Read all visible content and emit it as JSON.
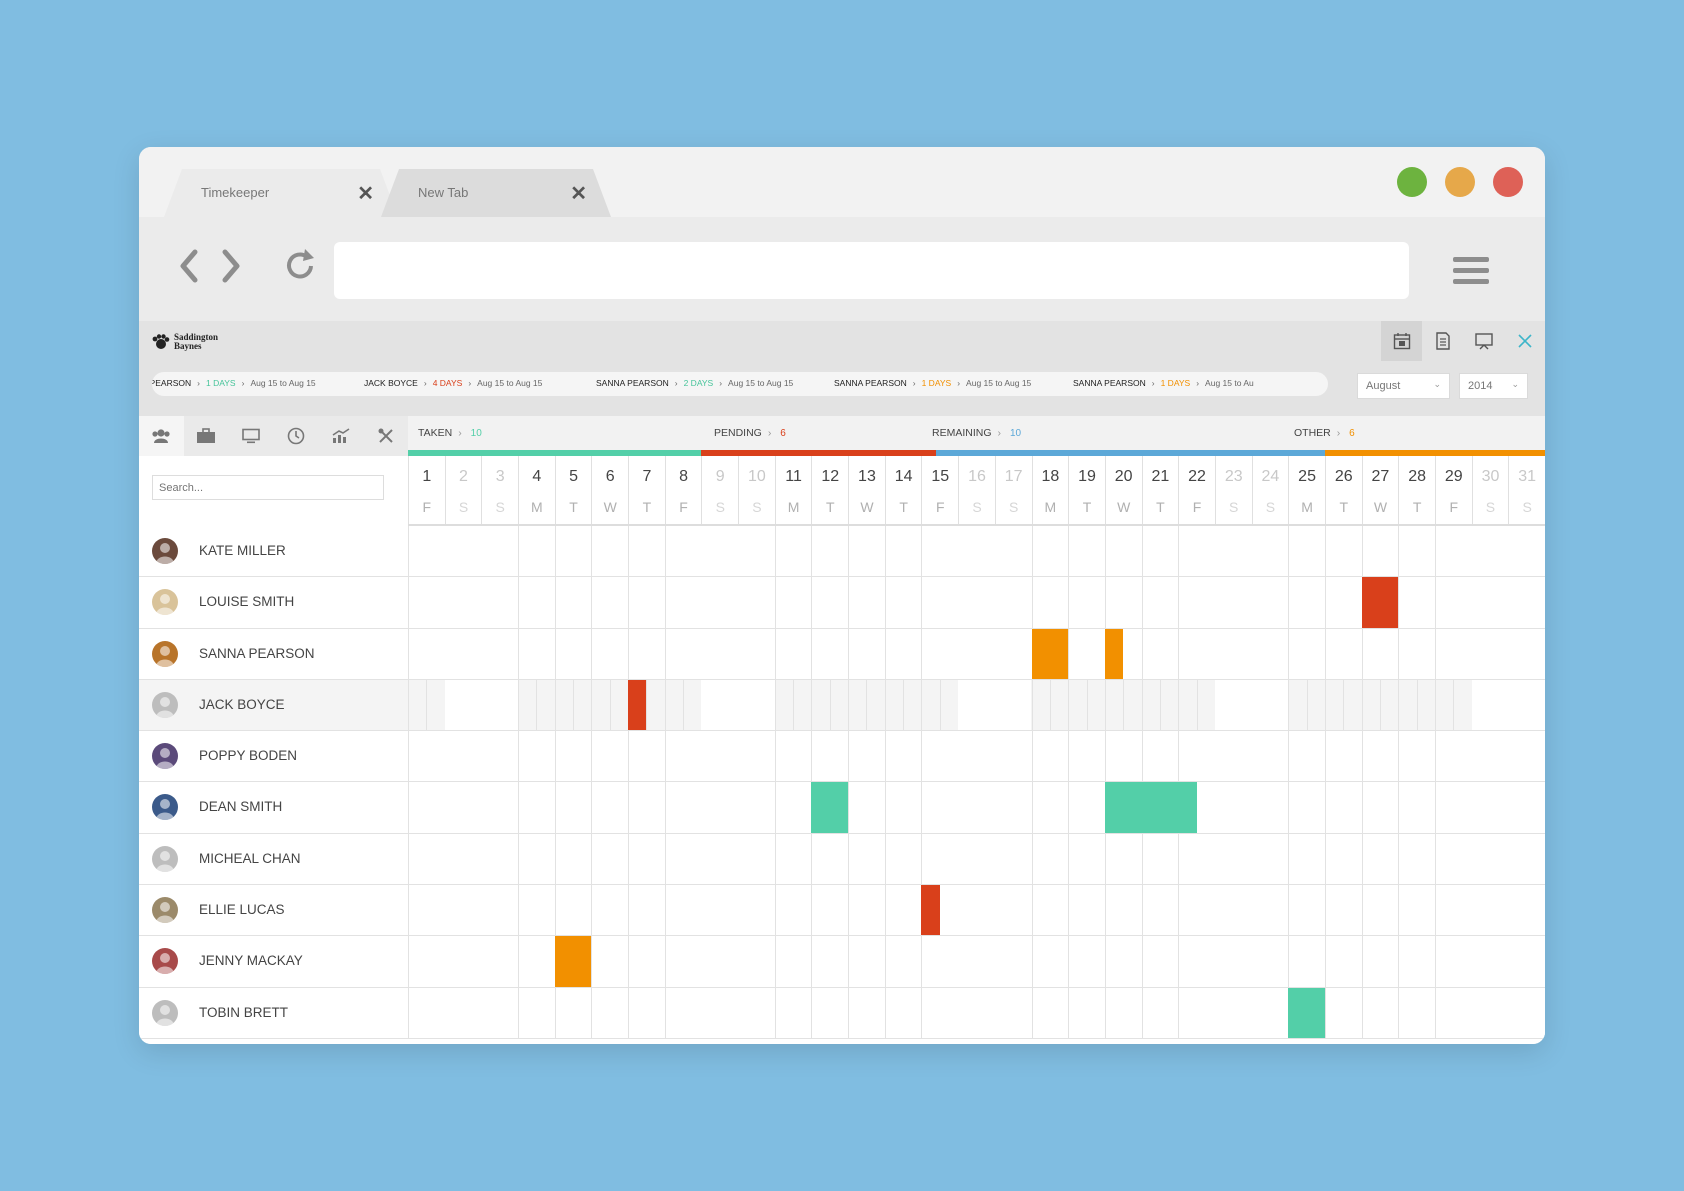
{
  "tabs": [
    {
      "label": "Timekeeper",
      "close": "✕"
    },
    {
      "label": "New Tab",
      "close": "✕"
    }
  ],
  "traffic_lights": [
    "#6db33f",
    "#e6a84a",
    "#de6157"
  ],
  "app": {
    "logo_line1": "Saddington",
    "logo_line2": "Baynes"
  },
  "ticker": [
    {
      "name": "A PEARSON",
      "days": "1 DAYS",
      "days_color": "#47c49a",
      "range": "Aug 15 to Aug 15"
    },
    {
      "name": "JACK BOYCE",
      "days": "4 DAYS",
      "days_color": "#d9401b",
      "range": "Aug 15 to Aug 15"
    },
    {
      "name": "SANNA PEARSON",
      "days": "2 DAYS",
      "days_color": "#47c49a",
      "range": "Aug 15 to Aug 15"
    },
    {
      "name": "SANNA PEARSON",
      "days": "1 DAYS",
      "days_color": "#f29000",
      "range": "Aug 15 to Aug 15"
    },
    {
      "name": "SANNA PEARSON",
      "days": "1 DAYS",
      "days_color": "#f29000",
      "range": "Aug 15 to Au"
    }
  ],
  "month_select": "August",
  "year_select": "2014",
  "search_placeholder": "Search...",
  "status": [
    {
      "label": "TAKEN",
      "value": "10",
      "color": "#53cfa8"
    },
    {
      "label": "PENDING",
      "value": "6",
      "color": "#d9401b"
    },
    {
      "label": "REMAINING",
      "value": "10",
      "color": "#5ca8d8"
    },
    {
      "label": "OTHER",
      "value": "6",
      "color": "#f29000"
    }
  ],
  "days": [
    {
      "n": "1",
      "w": "F"
    },
    {
      "n": "2",
      "w": "S"
    },
    {
      "n": "3",
      "w": "S"
    },
    {
      "n": "4",
      "w": "M"
    },
    {
      "n": "5",
      "w": "T"
    },
    {
      "n": "6",
      "w": "W"
    },
    {
      "n": "7",
      "w": "T"
    },
    {
      "n": "8",
      "w": "F"
    },
    {
      "n": "9",
      "w": "S"
    },
    {
      "n": "10",
      "w": "S"
    },
    {
      "n": "11",
      "w": "M"
    },
    {
      "n": "12",
      "w": "T"
    },
    {
      "n": "13",
      "w": "W"
    },
    {
      "n": "14",
      "w": "T"
    },
    {
      "n": "15",
      "w": "F"
    },
    {
      "n": "16",
      "w": "S"
    },
    {
      "n": "17",
      "w": "S"
    },
    {
      "n": "18",
      "w": "M"
    },
    {
      "n": "19",
      "w": "T"
    },
    {
      "n": "20",
      "w": "W"
    },
    {
      "n": "21",
      "w": "T"
    },
    {
      "n": "22",
      "w": "F"
    },
    {
      "n": "23",
      "w": "S"
    },
    {
      "n": "24",
      "w": "S"
    },
    {
      "n": "25",
      "w": "M"
    },
    {
      "n": "26",
      "w": "T"
    },
    {
      "n": "27",
      "w": "W"
    },
    {
      "n": "28",
      "w": "T"
    },
    {
      "n": "29",
      "w": "F"
    },
    {
      "n": "30",
      "w": "S"
    },
    {
      "n": "31",
      "w": "S"
    }
  ],
  "people": [
    {
      "name": "KATE MILLER",
      "avatar": "#6b4a3c",
      "blocks": []
    },
    {
      "name": "LOUISE SMITH",
      "avatar": "#d9c39a",
      "blocks": [
        {
          "start": 27,
          "len": 1,
          "color": "#d9401b"
        }
      ]
    },
    {
      "name": "SANNA PEARSON",
      "avatar": "#b8742a",
      "blocks": [
        {
          "start": 18,
          "len": 1,
          "color": "#f29000"
        },
        {
          "start": 20,
          "len": 0.5,
          "color": "#f29000"
        }
      ]
    },
    {
      "name": "JACK BOYCE",
      "avatar": "#bdbdbd",
      "highlight": true,
      "blocks": [
        {
          "start": 7,
          "len": 0.5,
          "color": "#d9401b"
        }
      ]
    },
    {
      "name": "POPPY BODEN",
      "avatar": "#5b4a7a",
      "blocks": []
    },
    {
      "name": "DEAN SMITH",
      "avatar": "#3b5a8a",
      "blocks": [
        {
          "start": 12,
          "len": 1,
          "color": "#53cfa8"
        },
        {
          "start": 20,
          "len": 2.5,
          "color": "#53cfa8"
        }
      ]
    },
    {
      "name": "MICHEAL CHAN",
      "avatar": "#bdbdbd",
      "blocks": []
    },
    {
      "name": "ELLIE LUCAS",
      "avatar": "#9b8a6a",
      "blocks": [
        {
          "start": 15,
          "len": 0.5,
          "color": "#d9401b"
        }
      ]
    },
    {
      "name": "JENNY MACKAY",
      "avatar": "#a84a4a",
      "blocks": [
        {
          "start": 5,
          "len": 1,
          "color": "#f29000"
        }
      ]
    },
    {
      "name": "TOBIN BRETT",
      "avatar": "#bdbdbd",
      "blocks": [
        {
          "start": 25,
          "len": 1,
          "color": "#53cfa8"
        }
      ]
    }
  ]
}
